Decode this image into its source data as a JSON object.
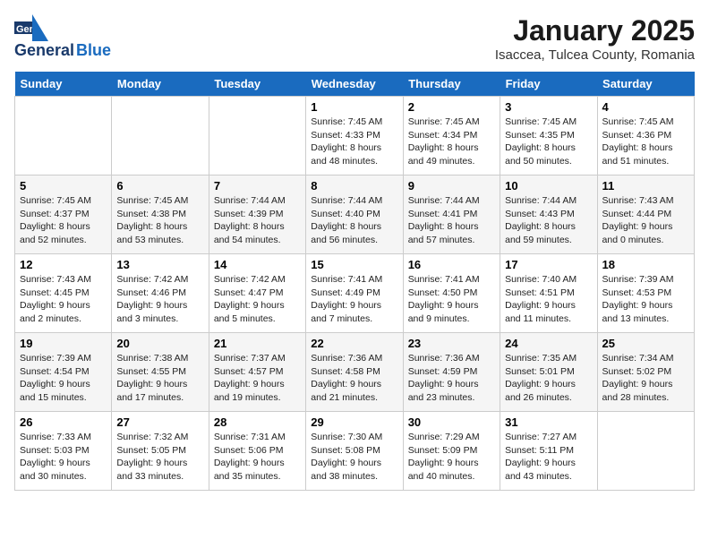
{
  "header": {
    "logo": {
      "line1": "General",
      "line2": "Blue"
    },
    "title": "January 2025",
    "subtitle": "Isaccea, Tulcea County, Romania"
  },
  "weekdays": [
    "Sunday",
    "Monday",
    "Tuesday",
    "Wednesday",
    "Thursday",
    "Friday",
    "Saturday"
  ],
  "weeks": [
    [
      {
        "day": null
      },
      {
        "day": null
      },
      {
        "day": null
      },
      {
        "day": "1",
        "sunrise": "7:45 AM",
        "sunset": "4:33 PM",
        "daylight": "8 hours and 48 minutes."
      },
      {
        "day": "2",
        "sunrise": "7:45 AM",
        "sunset": "4:34 PM",
        "daylight": "8 hours and 49 minutes."
      },
      {
        "day": "3",
        "sunrise": "7:45 AM",
        "sunset": "4:35 PM",
        "daylight": "8 hours and 50 minutes."
      },
      {
        "day": "4",
        "sunrise": "7:45 AM",
        "sunset": "4:36 PM",
        "daylight": "8 hours and 51 minutes."
      }
    ],
    [
      {
        "day": "5",
        "sunrise": "7:45 AM",
        "sunset": "4:37 PM",
        "daylight": "8 hours and 52 minutes."
      },
      {
        "day": "6",
        "sunrise": "7:45 AM",
        "sunset": "4:38 PM",
        "daylight": "8 hours and 53 minutes."
      },
      {
        "day": "7",
        "sunrise": "7:44 AM",
        "sunset": "4:39 PM",
        "daylight": "8 hours and 54 minutes."
      },
      {
        "day": "8",
        "sunrise": "7:44 AM",
        "sunset": "4:40 PM",
        "daylight": "8 hours and 56 minutes."
      },
      {
        "day": "9",
        "sunrise": "7:44 AM",
        "sunset": "4:41 PM",
        "daylight": "8 hours and 57 minutes."
      },
      {
        "day": "10",
        "sunrise": "7:44 AM",
        "sunset": "4:43 PM",
        "daylight": "8 hours and 59 minutes."
      },
      {
        "day": "11",
        "sunrise": "7:43 AM",
        "sunset": "4:44 PM",
        "daylight": "9 hours and 0 minutes."
      }
    ],
    [
      {
        "day": "12",
        "sunrise": "7:43 AM",
        "sunset": "4:45 PM",
        "daylight": "9 hours and 2 minutes."
      },
      {
        "day": "13",
        "sunrise": "7:42 AM",
        "sunset": "4:46 PM",
        "daylight": "9 hours and 3 minutes."
      },
      {
        "day": "14",
        "sunrise": "7:42 AM",
        "sunset": "4:47 PM",
        "daylight": "9 hours and 5 minutes."
      },
      {
        "day": "15",
        "sunrise": "7:41 AM",
        "sunset": "4:49 PM",
        "daylight": "9 hours and 7 minutes."
      },
      {
        "day": "16",
        "sunrise": "7:41 AM",
        "sunset": "4:50 PM",
        "daylight": "9 hours and 9 minutes."
      },
      {
        "day": "17",
        "sunrise": "7:40 AM",
        "sunset": "4:51 PM",
        "daylight": "9 hours and 11 minutes."
      },
      {
        "day": "18",
        "sunrise": "7:39 AM",
        "sunset": "4:53 PM",
        "daylight": "9 hours and 13 minutes."
      }
    ],
    [
      {
        "day": "19",
        "sunrise": "7:39 AM",
        "sunset": "4:54 PM",
        "daylight": "9 hours and 15 minutes."
      },
      {
        "day": "20",
        "sunrise": "7:38 AM",
        "sunset": "4:55 PM",
        "daylight": "9 hours and 17 minutes."
      },
      {
        "day": "21",
        "sunrise": "7:37 AM",
        "sunset": "4:57 PM",
        "daylight": "9 hours and 19 minutes."
      },
      {
        "day": "22",
        "sunrise": "7:36 AM",
        "sunset": "4:58 PM",
        "daylight": "9 hours and 21 minutes."
      },
      {
        "day": "23",
        "sunrise": "7:36 AM",
        "sunset": "4:59 PM",
        "daylight": "9 hours and 23 minutes."
      },
      {
        "day": "24",
        "sunrise": "7:35 AM",
        "sunset": "5:01 PM",
        "daylight": "9 hours and 26 minutes."
      },
      {
        "day": "25",
        "sunrise": "7:34 AM",
        "sunset": "5:02 PM",
        "daylight": "9 hours and 28 minutes."
      }
    ],
    [
      {
        "day": "26",
        "sunrise": "7:33 AM",
        "sunset": "5:03 PM",
        "daylight": "9 hours and 30 minutes."
      },
      {
        "day": "27",
        "sunrise": "7:32 AM",
        "sunset": "5:05 PM",
        "daylight": "9 hours and 33 minutes."
      },
      {
        "day": "28",
        "sunrise": "7:31 AM",
        "sunset": "5:06 PM",
        "daylight": "9 hours and 35 minutes."
      },
      {
        "day": "29",
        "sunrise": "7:30 AM",
        "sunset": "5:08 PM",
        "daylight": "9 hours and 38 minutes."
      },
      {
        "day": "30",
        "sunrise": "7:29 AM",
        "sunset": "5:09 PM",
        "daylight": "9 hours and 40 minutes."
      },
      {
        "day": "31",
        "sunrise": "7:27 AM",
        "sunset": "5:11 PM",
        "daylight": "9 hours and 43 minutes."
      },
      {
        "day": null
      }
    ]
  ]
}
